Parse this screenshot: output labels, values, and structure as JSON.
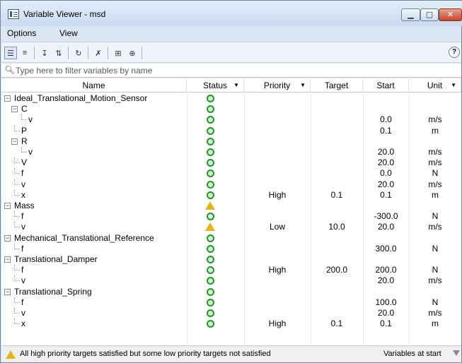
{
  "window": {
    "title": "Variable Viewer - msd"
  },
  "menu": {
    "options": "Options",
    "view": "View"
  },
  "toolbar": {
    "help_label": "?"
  },
  "filter": {
    "placeholder": "Type here to filter variables by name"
  },
  "columns": {
    "name": "Name",
    "status": "Status",
    "priority": "Priority",
    "target": "Target",
    "start": "Start",
    "unit": "Unit"
  },
  "rows": [
    {
      "name": "Ideal_Translational_Motion_Sensor",
      "level": 0,
      "expander": "minus",
      "status": "ok",
      "priority": "",
      "target": "",
      "start": "",
      "unit": ""
    },
    {
      "name": "C",
      "level": 1,
      "expander": "minus",
      "status": "ok",
      "priority": "",
      "target": "",
      "start": "",
      "unit": ""
    },
    {
      "name": "v",
      "level": 2,
      "expander": "leaf",
      "status": "ok",
      "priority": "",
      "target": "",
      "start": "0.0",
      "unit": "m/s"
    },
    {
      "name": "P",
      "level": 1,
      "expander": "leaf",
      "status": "ok",
      "priority": "",
      "target": "",
      "start": "0.1",
      "unit": "m"
    },
    {
      "name": "R",
      "level": 1,
      "expander": "minus",
      "status": "ok",
      "priority": "",
      "target": "",
      "start": "",
      "unit": ""
    },
    {
      "name": "v",
      "level": 2,
      "expander": "leaf",
      "status": "ok",
      "priority": "",
      "target": "",
      "start": "20.0",
      "unit": "m/s"
    },
    {
      "name": "V",
      "level": 1,
      "expander": "leaf",
      "status": "ok",
      "priority": "",
      "target": "",
      "start": "20.0",
      "unit": "m/s"
    },
    {
      "name": "f",
      "level": 1,
      "expander": "leaf",
      "status": "ok",
      "priority": "",
      "target": "",
      "start": "0.0",
      "unit": "N"
    },
    {
      "name": "v",
      "level": 1,
      "expander": "leaf",
      "status": "ok",
      "priority": "",
      "target": "",
      "start": "20.0",
      "unit": "m/s"
    },
    {
      "name": "x",
      "level": 1,
      "expander": "leaf",
      "status": "ok",
      "priority": "High",
      "target": "0.1",
      "start": "0.1",
      "unit": "m"
    },
    {
      "name": "Mass",
      "level": 0,
      "expander": "minus",
      "status": "warn",
      "priority": "",
      "target": "",
      "start": "",
      "unit": ""
    },
    {
      "name": "f",
      "level": 1,
      "expander": "leaf",
      "status": "ok",
      "priority": "",
      "target": "",
      "start": "-300.0",
      "unit": "N"
    },
    {
      "name": "v",
      "level": 1,
      "expander": "leaf",
      "status": "warn",
      "priority": "Low",
      "target": "10.0",
      "start": "20.0",
      "unit": "m/s"
    },
    {
      "name": "Mechanical_Translational_Reference",
      "level": 0,
      "expander": "minus",
      "status": "ok",
      "priority": "",
      "target": "",
      "start": "",
      "unit": ""
    },
    {
      "name": "f",
      "level": 1,
      "expander": "leaf",
      "status": "ok",
      "priority": "",
      "target": "",
      "start": "300.0",
      "unit": "N"
    },
    {
      "name": "Translational_Damper",
      "level": 0,
      "expander": "minus",
      "status": "ok",
      "priority": "",
      "target": "",
      "start": "",
      "unit": ""
    },
    {
      "name": "f",
      "level": 1,
      "expander": "leaf",
      "status": "ok",
      "priority": "High",
      "target": "200.0",
      "start": "200.0",
      "unit": "N"
    },
    {
      "name": "v",
      "level": 1,
      "expander": "leaf",
      "status": "ok",
      "priority": "",
      "target": "",
      "start": "20.0",
      "unit": "m/s"
    },
    {
      "name": "Translational_Spring",
      "level": 0,
      "expander": "minus",
      "status": "ok",
      "priority": "",
      "target": "",
      "start": "",
      "unit": ""
    },
    {
      "name": "f",
      "level": 1,
      "expander": "leaf",
      "status": "ok",
      "priority": "",
      "target": "",
      "start": "100.0",
      "unit": "N"
    },
    {
      "name": "v",
      "level": 1,
      "expander": "leaf",
      "status": "ok",
      "priority": "",
      "target": "",
      "start": "20.0",
      "unit": "m/s"
    },
    {
      "name": "x",
      "level": 1,
      "expander": "leaf",
      "status": "ok",
      "priority": "High",
      "target": "0.1",
      "start": "0.1",
      "unit": "m"
    }
  ],
  "statusbar": {
    "message": "All high priority targets satisfied but some low priority targets not satisfied",
    "right": "Variables at start"
  },
  "colors": {
    "ok": "#1f9b1f",
    "warn": "#e7b418",
    "title_bg": "#dbe7f5"
  }
}
